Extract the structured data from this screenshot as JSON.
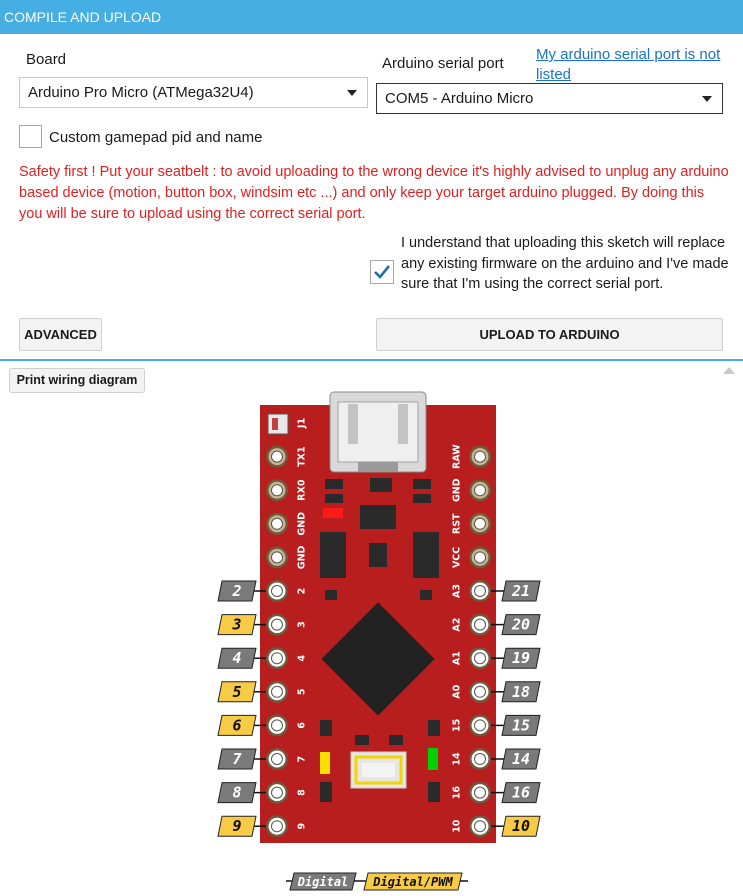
{
  "header": {
    "title": "COMPILE AND UPLOAD"
  },
  "board": {
    "label": "Board",
    "selected": "Arduino Pro Micro (ATMega32U4)"
  },
  "port": {
    "label": "Arduino serial port",
    "selected": "COM5 - Arduino Micro",
    "help_link": "My arduino serial port is not listed"
  },
  "custom_pid": {
    "label": "Custom gamepad pid and name",
    "checked": false
  },
  "warning": "Safety first ! Put your seatbelt : to avoid uploading to the wrong device it's highly advised to unplug any arduino based device (motion, button box, windsim etc ...) and only keep your target arduino plugged. By doing this you will be sure to upload using the correct serial port.",
  "acknowledge": {
    "label": "I understand that uploading this sketch will replace any existing firmware on the arduino and I've made sure that I'm using the correct serial port.",
    "checked": true
  },
  "buttons": {
    "advanced": "ADVANCED",
    "upload": "UPLOAD TO ARDUINO",
    "print": "Print wiring diagram"
  },
  "diagram": {
    "left_pins": [
      {
        "silk": "J1",
        "tag": ""
      },
      {
        "silk": "TX1",
        "tag": ""
      },
      {
        "silk": "RX0",
        "tag": ""
      },
      {
        "silk": "GND",
        "tag": ""
      },
      {
        "silk": "GND",
        "tag": ""
      },
      {
        "silk": "2",
        "tag": "2",
        "pwm": false
      },
      {
        "silk": "3",
        "tag": "3",
        "pwm": true
      },
      {
        "silk": "4",
        "tag": "4",
        "pwm": false
      },
      {
        "silk": "5",
        "tag": "5",
        "pwm": true
      },
      {
        "silk": "6",
        "tag": "6",
        "pwm": true
      },
      {
        "silk": "7",
        "tag": "7",
        "pwm": false
      },
      {
        "silk": "8",
        "tag": "8",
        "pwm": false
      },
      {
        "silk": "9",
        "tag": "9",
        "pwm": true
      }
    ],
    "right_pins": [
      {
        "silk": "RAW",
        "tag": ""
      },
      {
        "silk": "GND",
        "tag": ""
      },
      {
        "silk": "RST",
        "tag": ""
      },
      {
        "silk": "VCC",
        "tag": ""
      },
      {
        "silk": "A3",
        "tag": "21",
        "pwm": false
      },
      {
        "silk": "A2",
        "tag": "20",
        "pwm": false
      },
      {
        "silk": "A1",
        "tag": "19",
        "pwm": false
      },
      {
        "silk": "A0",
        "tag": "18",
        "pwm": false
      },
      {
        "silk": "15",
        "tag": "15",
        "pwm": false
      },
      {
        "silk": "14",
        "tag": "14",
        "pwm": false
      },
      {
        "silk": "16",
        "tag": "16",
        "pwm": false
      },
      {
        "silk": "10",
        "tag": "10",
        "pwm": true
      }
    ],
    "legend": {
      "digital": "Digital",
      "pwm": "Digital/PWM"
    }
  },
  "colors": {
    "accent": "#45aee2",
    "warning": "#e02020",
    "board": "#b81e1e",
    "digital_tag": "#7a7a7a",
    "pwm_tag": "#f7cb45"
  }
}
